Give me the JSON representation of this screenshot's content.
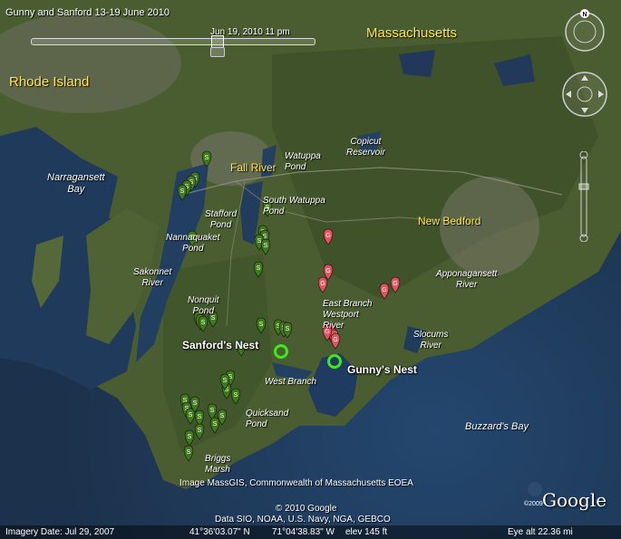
{
  "title": "Gunny and Sanford 13-19 June 2010",
  "time_slider": {
    "label": "Jun 19, 2010  11 pm"
  },
  "states": {
    "massachusetts": "Massachusetts",
    "rhode_island": "Rhode Island"
  },
  "cities": {
    "fall_river": "Fall River",
    "new_bedford": "New Bedford"
  },
  "water_labels": {
    "narragansett": "Narragansett\nBay",
    "watuppa": "Watuppa\nPond",
    "copicut": "Copicut\nReservoir",
    "south_watuppa": "South Watuppa\nPond",
    "stafford": "Stafford\nPond",
    "nannaquaket": "Nannaquaket\nPond",
    "sakonnet": "Sakonnet\nRiver",
    "nonquit": "Nonquit\nPond",
    "east_branch": "East Branch\nWestport\nRiver",
    "apponagansett": "Apponagansett\nRiver",
    "slocums": "Slocums\nRiver",
    "west_branch": "West Branch",
    "quicksand": "Quicksand\nPond",
    "briggs": "Briggs\nMarsh",
    "buzzards": "Buzzard's Bay"
  },
  "nests": {
    "sanford": "Sanford's Nest",
    "gunny": "Gunny's Nest"
  },
  "markers": {
    "green_color": "#3f7a1a",
    "red_color": "#e8505b",
    "ring_color": "#3fe81a",
    "green_letter": "S",
    "red_letter": "G"
  },
  "credits": {
    "imagery": "Image MassGIS, Commonwealth of Massachusetts EOEA",
    "copyright": "© 2010 Google",
    "data": "Data SIO, NOAA, U.S. Navy, NGA, GEBCO"
  },
  "status_bar": {
    "imagery_date": "Imagery Date: Jul 29, 2007",
    "lat": "41°36'03.07\" N",
    "lon": "71°04'38.83\" W",
    "elev": "elev   145 ft",
    "eye_alt": "Eye alt    22.36 mi"
  },
  "logo": {
    "text": "Google",
    "small": "©2009"
  },
  "nav": {
    "north": "N"
  }
}
